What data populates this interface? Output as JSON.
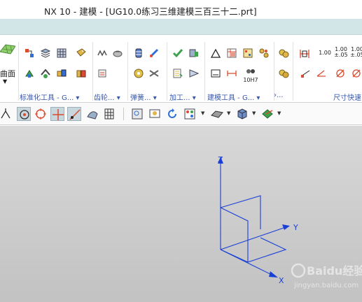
{
  "window": {
    "title": "NX 10 - 建模 - [UG10.0练习三维建模三百三十二.prt]"
  },
  "ribbon": {
    "face_label": "曲面",
    "groups": [
      {
        "label": "标准化工具 - G... ▾"
      },
      {
        "label": "齿轮... ▾"
      },
      {
        "label": "弹簧... ▾"
      },
      {
        "label": "加工... ▾"
      },
      {
        "label": "建模工具 - G... ▾"
      },
      {
        "label": "›..."
      },
      {
        "label": "尺寸快速"
      }
    ],
    "value_icons": [
      "1.00",
      "1.00",
      "±.05",
      "1.00",
      "±.05",
      "10H7"
    ]
  },
  "viewport": {
    "axes": {
      "z": "Z",
      "y": "Y",
      "x": "X"
    },
    "watermark_text": "Baidu经验",
    "watermark_url": "jingyan.baidu.com"
  },
  "colors": {
    "ribbon_strip": "#d3e6e7",
    "triad": "#1a3fd6",
    "group_label": "#3a57a8"
  }
}
